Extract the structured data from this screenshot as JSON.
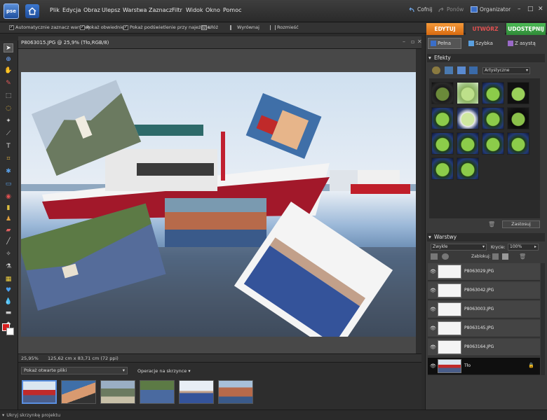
{
  "app": {
    "logo_text": "pse"
  },
  "menu": [
    "Plik",
    "Edycja",
    "Obraz",
    "Ulepsz",
    "Warstwa",
    "Zaznacz",
    "Filtr",
    "Widok",
    "Okno",
    "Pomoc"
  ],
  "header_right": {
    "undo": "Cofnij",
    "redo": "Ponów",
    "organizer": "Organizator"
  },
  "options": {
    "auto_select": "Automatycznie zaznacz warstwę",
    "show_bbox": "Pokaż obwiednię",
    "show_highlight": "Pokaż podświetlenie przy najeździe",
    "arrange": "Ułóż",
    "align": "Wyrównaj",
    "distribute": "Rozmieść"
  },
  "mode_tabs": [
    "EDYTUJ",
    "UTWÓRZ",
    "UDOSTĘPNIJ"
  ],
  "edit_tabs": [
    "Pełna",
    "Szybka",
    "Z asystą"
  ],
  "document": {
    "title": "P8063015.JPG @ 25,9% (Tło,RGB/8)"
  },
  "status": {
    "zoom": "25,95%",
    "size": "125,62 cm x 83,71 cm (72 ppi)"
  },
  "bin": {
    "show_label": "Pokaż otwarte pliki",
    "ops_label": "Operacje na skrzynce",
    "hide_label": "Ukryj skrzynkę projektu"
  },
  "effects": {
    "title": "Efekty",
    "category": "Artystyczne",
    "apply": "Zastosuj"
  },
  "layers": {
    "title": "Warstwy",
    "blend": "Zwykłe",
    "opacity_label": "Krycie:",
    "opacity_value": "100%",
    "lock_label": "Zablokuj:",
    "items": [
      "P8063029.JPG",
      "P8063042.JPG",
      "P8063003.JPG",
      "P8063145.JPG",
      "P8063164.JPG",
      "Tło"
    ]
  },
  "colors": {
    "accent_edit": "#e8731a",
    "accent_create": "#c8262a",
    "accent_share": "#3aa043",
    "selected": "#1e4fb0"
  }
}
